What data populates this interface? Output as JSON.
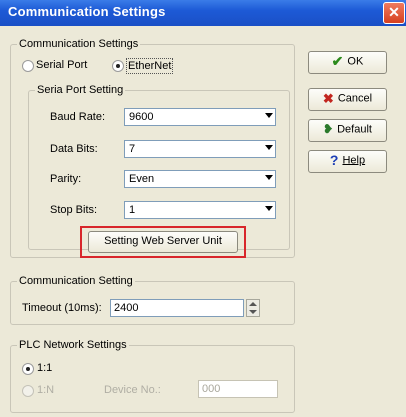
{
  "window": {
    "title": "Communication Settings",
    "close_glyph": "✕"
  },
  "comm": {
    "legend": "Communication Settings",
    "serial_port": "Serial Port",
    "ethernet": "EtherNet"
  },
  "serial": {
    "legend": "Seria Port Setting",
    "baud_label": "Baud Rate:",
    "baud_value": "9600",
    "data_bits_label": "Data Bits:",
    "data_bits_value": "7",
    "parity_label": "Parity:",
    "parity_value": "Even",
    "stop_bits_label": "Stop Bits:",
    "stop_bits_value": "1",
    "web_button": "Setting Web Server Unit"
  },
  "timeout": {
    "legend": "Communication Setting",
    "label": "Timeout (10ms):",
    "value": "2400"
  },
  "plc": {
    "legend": "PLC Network Settings",
    "one_to_one": "1:1",
    "one_to_n": "1:N",
    "device_no_label": "Device No.:",
    "device_no_value": "000"
  },
  "buttons": {
    "ok": "OK",
    "cancel": "Cancel",
    "default": "Default",
    "help": "Help"
  },
  "icons": {
    "ok": "check-icon",
    "cancel": "x-icon",
    "default": "default-icon",
    "help": "help-icon"
  },
  "colors": {
    "titlebar": "#1d5ad6",
    "highlight": "#d8262b",
    "check": "#2c8a1c",
    "cancel": "#c2261f",
    "help": "#1d3fb6"
  }
}
